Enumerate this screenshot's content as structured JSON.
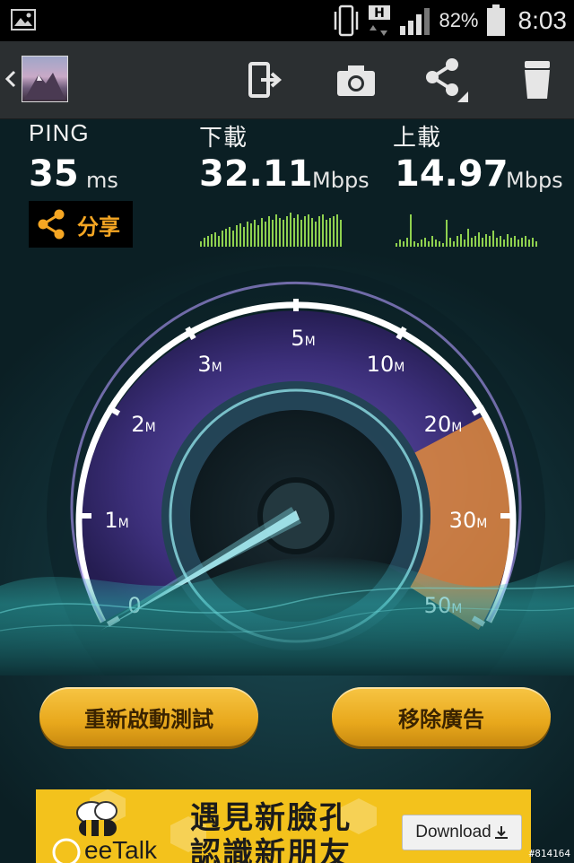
{
  "status_bar": {
    "network_type": "H",
    "battery_percent": "82%",
    "time": "8:03",
    "icons": [
      "gallery-icon",
      "vibrate-icon",
      "network-h-icon",
      "signal-icon",
      "battery-icon"
    ]
  },
  "action_bar": {
    "icons": [
      "back-chevron-icon",
      "result-thumbnail",
      "exit-app-icon",
      "camera-icon",
      "share-icon",
      "trash-icon"
    ]
  },
  "metrics": {
    "ping": {
      "label": "PING",
      "value": "35",
      "unit": "ms"
    },
    "download": {
      "label": "下載",
      "value": "32.11",
      "unit": "Mbps"
    },
    "upload": {
      "label": "上載",
      "value": "14.97",
      "unit": "Mbps"
    }
  },
  "share_button": {
    "label": "分享"
  },
  "gauge": {
    "tick_labels": [
      {
        "num": "0",
        "unit": ""
      },
      {
        "num": "1",
        "unit": "M"
      },
      {
        "num": "2",
        "unit": "M"
      },
      {
        "num": "3",
        "unit": "M"
      },
      {
        "num": "5",
        "unit": "M"
      },
      {
        "num": "10",
        "unit": "M"
      },
      {
        "num": "20",
        "unit": "M"
      },
      {
        "num": "30",
        "unit": "M"
      },
      {
        "num": "50",
        "unit": "M"
      }
    ],
    "needle_value_label": "0",
    "colors": {
      "rim": "#ffffff",
      "dial": "#4a3f8f",
      "highlight": "#e08a3c",
      "needle": "#9fe8f0"
    }
  },
  "buttons": {
    "restart_test": "重新啟動測試",
    "remove_ads": "移除廣告"
  },
  "ad": {
    "brand": "eeTalk",
    "line1": "遇見新臉孔",
    "line2": "認識新朋友",
    "download_label": "Download"
  },
  "watermark": "#814164"
}
